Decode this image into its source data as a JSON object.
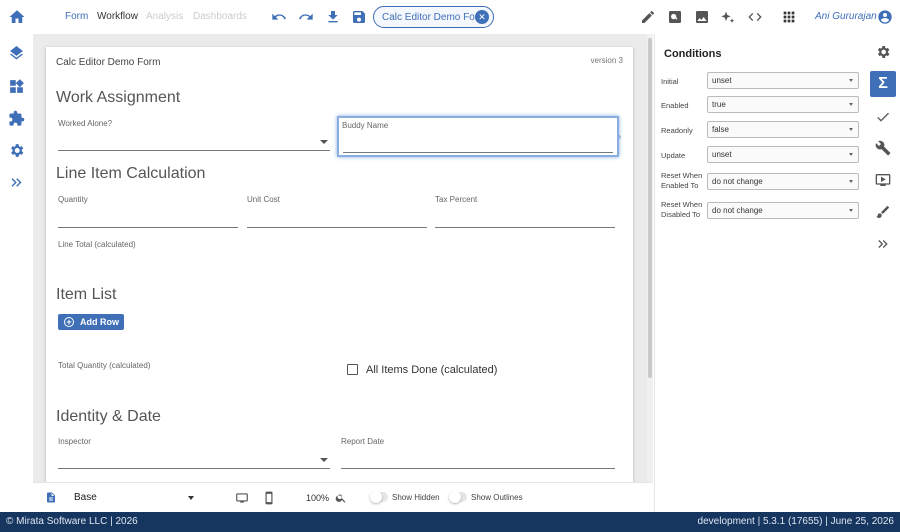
{
  "header": {
    "tabs": [
      "Form",
      "Workflow",
      "Analysis",
      "Dashboards"
    ],
    "form_chip_label": "Calc Editor Demo Form",
    "user_name": "Ani Gururajan"
  },
  "form": {
    "title": "Calc Editor Demo Form",
    "version": "version 3",
    "sections": {
      "work_assignment": "Work Assignment",
      "line_item_calc": "Line Item Calculation",
      "item_list": "Item List",
      "identity_date": "Identity & Date"
    },
    "fields": {
      "worked_alone": "Worked Alone?",
      "buddy_name": "Buddy Name",
      "quantity": "Quantity",
      "unit_cost": "Unit Cost",
      "tax_percent": "Tax Percent",
      "line_total": "Line Total (calculated)",
      "total_quantity": "Total Quantity (calculated)",
      "all_items_done": "All Items Done (calculated)",
      "inspector": "Inspector",
      "report_date": "Report Date"
    },
    "add_row_label": "Add Row"
  },
  "bottom_toolbar": {
    "layout_select": "Base",
    "zoom": "100%",
    "show_hidden": "Show Hidden",
    "show_outlines": "Show Outlines"
  },
  "conditions_panel": {
    "title": "Conditions",
    "properties": [
      {
        "label": "Initial",
        "value": "unset"
      },
      {
        "label": "Enabled",
        "value": "true"
      },
      {
        "label": "Readonly",
        "value": "false"
      },
      {
        "label": "Update",
        "value": "unset"
      },
      {
        "label": "Reset When Enabled To",
        "value": "do not change"
      },
      {
        "label": "Reset When Disabled To",
        "value": "do not change"
      }
    ]
  },
  "footer": {
    "copyright": "© Mirata Software LLC | 2026",
    "version_info": "development | 5.3.1 (17655) | June 25, 2026"
  },
  "colors": {
    "accent": "#3f6fb7",
    "footer_bg": "#16365f",
    "canvas_bg": "#ebebeb"
  },
  "icons": {
    "top_left": "home-icon",
    "toolbar": [
      "undo-icon",
      "redo-icon",
      "download-icon",
      "save-icon"
    ],
    "top_right": [
      "pencil-icon",
      "preview-icon",
      "image-icon",
      "sparkle-icon",
      "code-icon",
      "apps-grid-icon",
      "account-icon"
    ],
    "left_rail": [
      "layers-icon",
      "widgets-icon",
      "puzzle-icon",
      "settings-icon",
      "expand-icon"
    ],
    "right_rail": [
      "gear-icon",
      "sigma-icon",
      "check-icon",
      "wrench-icon",
      "play-icon",
      "brush-icon",
      "expand-icon"
    ]
  }
}
